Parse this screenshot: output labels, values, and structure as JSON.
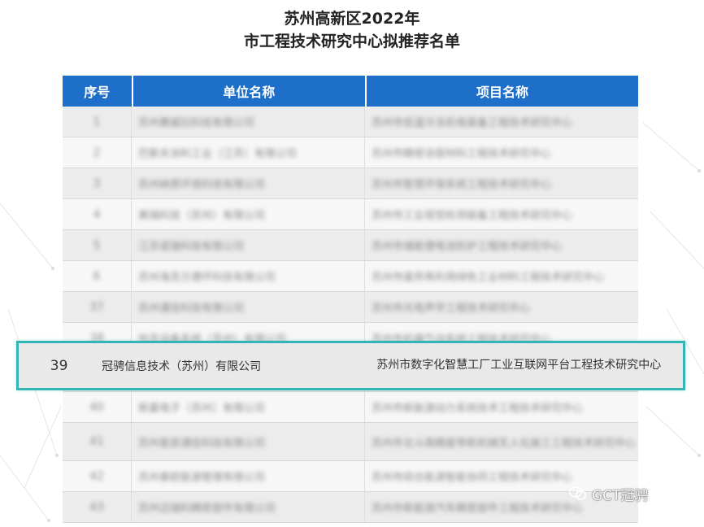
{
  "header": {
    "title_line1": "苏州高新区2022年",
    "title_line2": "市工程技术研究中心拟推荐名单"
  },
  "table": {
    "columns": [
      "序号",
      "单位名称",
      "项目名称"
    ],
    "rows": [
      {
        "no": "1",
        "unit": "苏州赛威拉科技有限公司",
        "project": "苏州市低温冷冻机电装备工程技术研究中心",
        "tall": false
      },
      {
        "no": "2",
        "unit": "巴斯夫涂料工业（江苏）有限公司",
        "project": "苏州市精密涂层材料工程技术研究中心",
        "tall": false
      },
      {
        "no": "3",
        "unit": "苏州纳思环境科技有限公司",
        "project": "苏州市智慧环保系统工程技术研究中心",
        "tall": false
      },
      {
        "no": "4",
        "unit": "美瑞科技（苏州）有限公司",
        "project": "苏州市工业视觉检测装备工程技术研究中心",
        "tall": false
      },
      {
        "no": "5",
        "unit": "江苏诺瑞科技有限公司",
        "project": "苏州市储能锂电池防护工程技术研究中心",
        "tall": false
      },
      {
        "no": "6",
        "unit": "苏州海克兰德环科技有限公司",
        "project": "苏州市废弃再利用绿色工业材料工程技术研究中心",
        "tall": false
      },
      {
        "no": "37",
        "unit": "苏州通信科技有限公司",
        "project": "苏州市光电声学工程技术研究中心",
        "tall": false
      },
      {
        "no": "38",
        "unit": "哈克设备系统（苏州）有限公司",
        "project": "苏州市机器气动系统工程技术研究中心",
        "tall": false
      },
      {
        "no": "",
        "unit": "",
        "project": "",
        "tall": true
      },
      {
        "no": "40",
        "unit": "新嘉电子（苏州）有限公司",
        "project": "苏州市新能源动力系统技术工程技术研究中心",
        "tall": false
      },
      {
        "no": "41",
        "unit": "苏州星辰通信科技有限公司",
        "project": "苏州市北斗高精度导航机械无人化施工工程技术研究中心",
        "tall": true
      },
      {
        "no": "42",
        "unit": "苏州泰欧能源管理有限公司",
        "project": "苏州市综合能源智能协同工程技术研究中心",
        "tall": false
      },
      {
        "no": "43",
        "unit": "苏州迈瑞科精密部件有限公司",
        "project": "苏州市新能源汽车精密部件工程技术研究中心",
        "tall": false
      }
    ]
  },
  "highlight": {
    "no": "39",
    "unit": "冠骋信息技术（苏州）有限公司",
    "project": "苏州市数字化智慧工厂工业互联网平台工程技术研究中心"
  },
  "watermark": {
    "text": "GCT冠骋",
    "icon": "wechat-icon"
  }
}
